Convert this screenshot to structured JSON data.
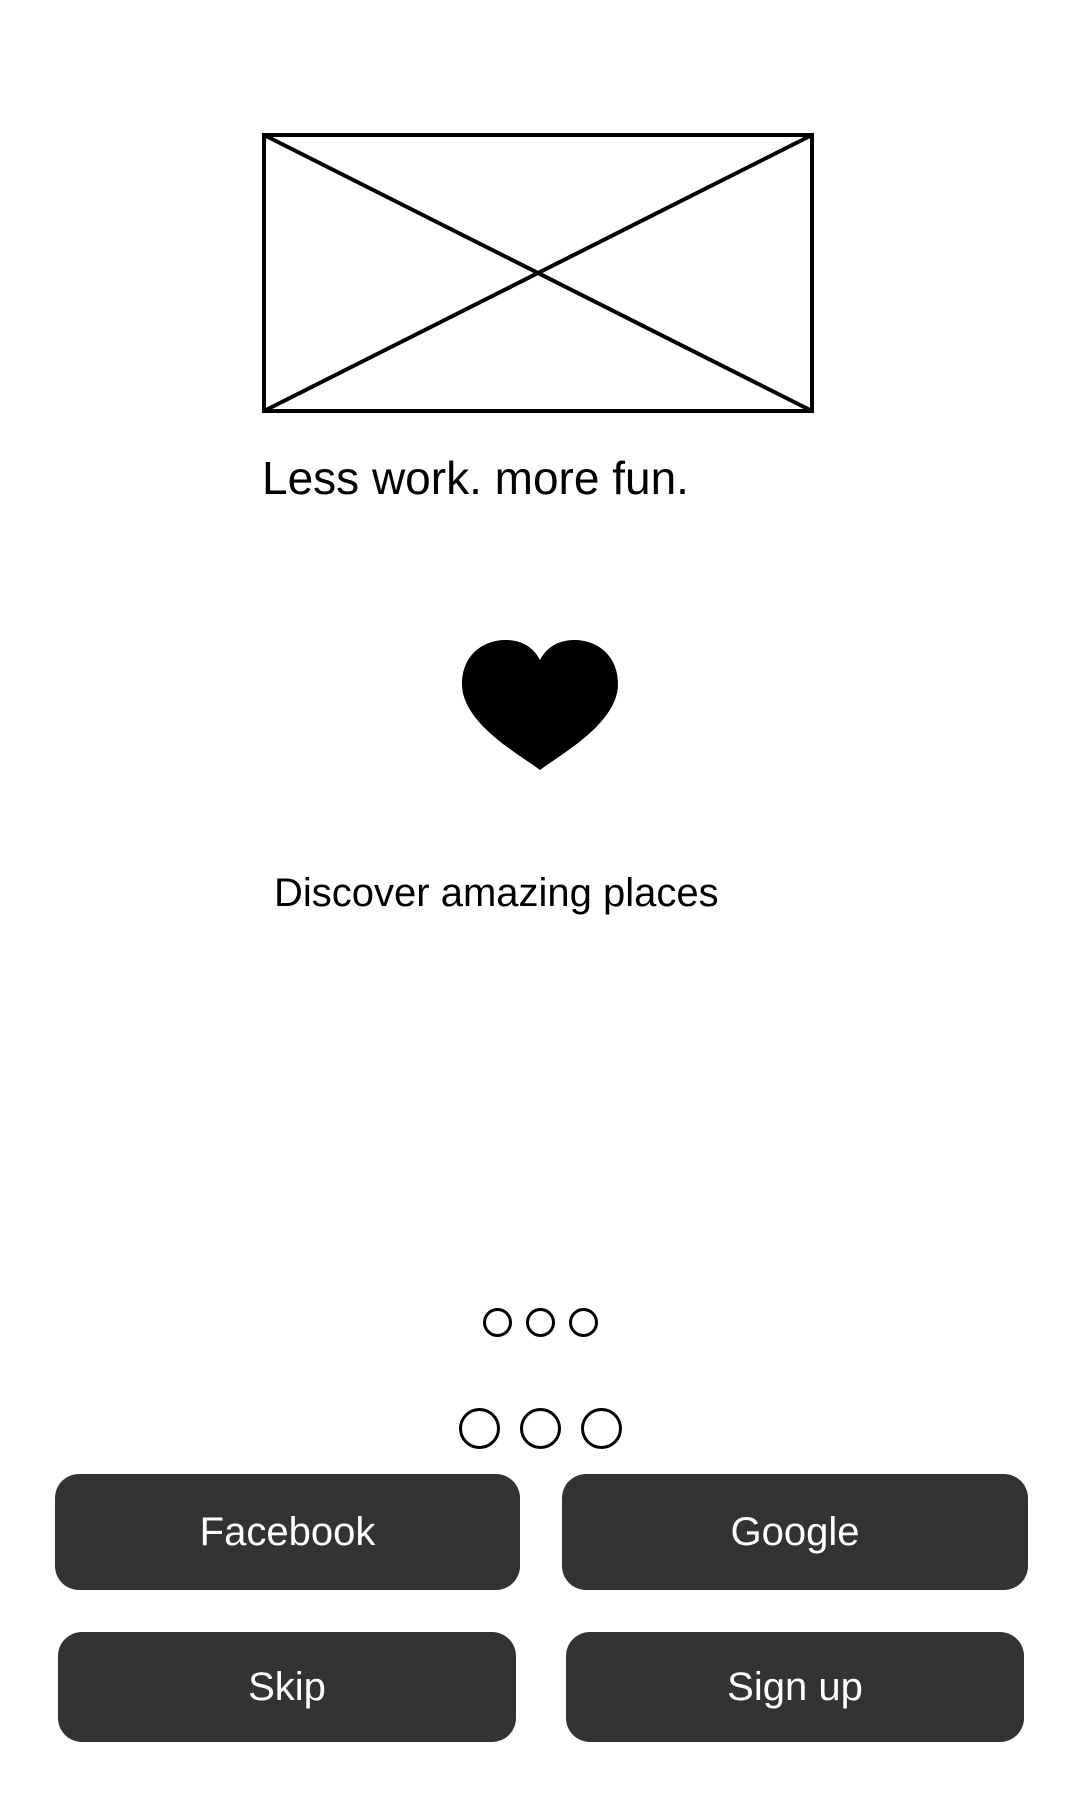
{
  "onboarding": {
    "headline": "Less work. more fun.",
    "subtitle": "Discover amazing places",
    "icon": "heart-icon"
  },
  "pager": {
    "small_dots": 3,
    "large_dots": 3
  },
  "social_login": {
    "facebook_label": "Facebook",
    "google_label": "Google"
  },
  "actions": {
    "skip_label": "Skip",
    "signup_label": "Sign up"
  },
  "colors": {
    "button_background": "#333333",
    "button_text": "#ffffff"
  }
}
